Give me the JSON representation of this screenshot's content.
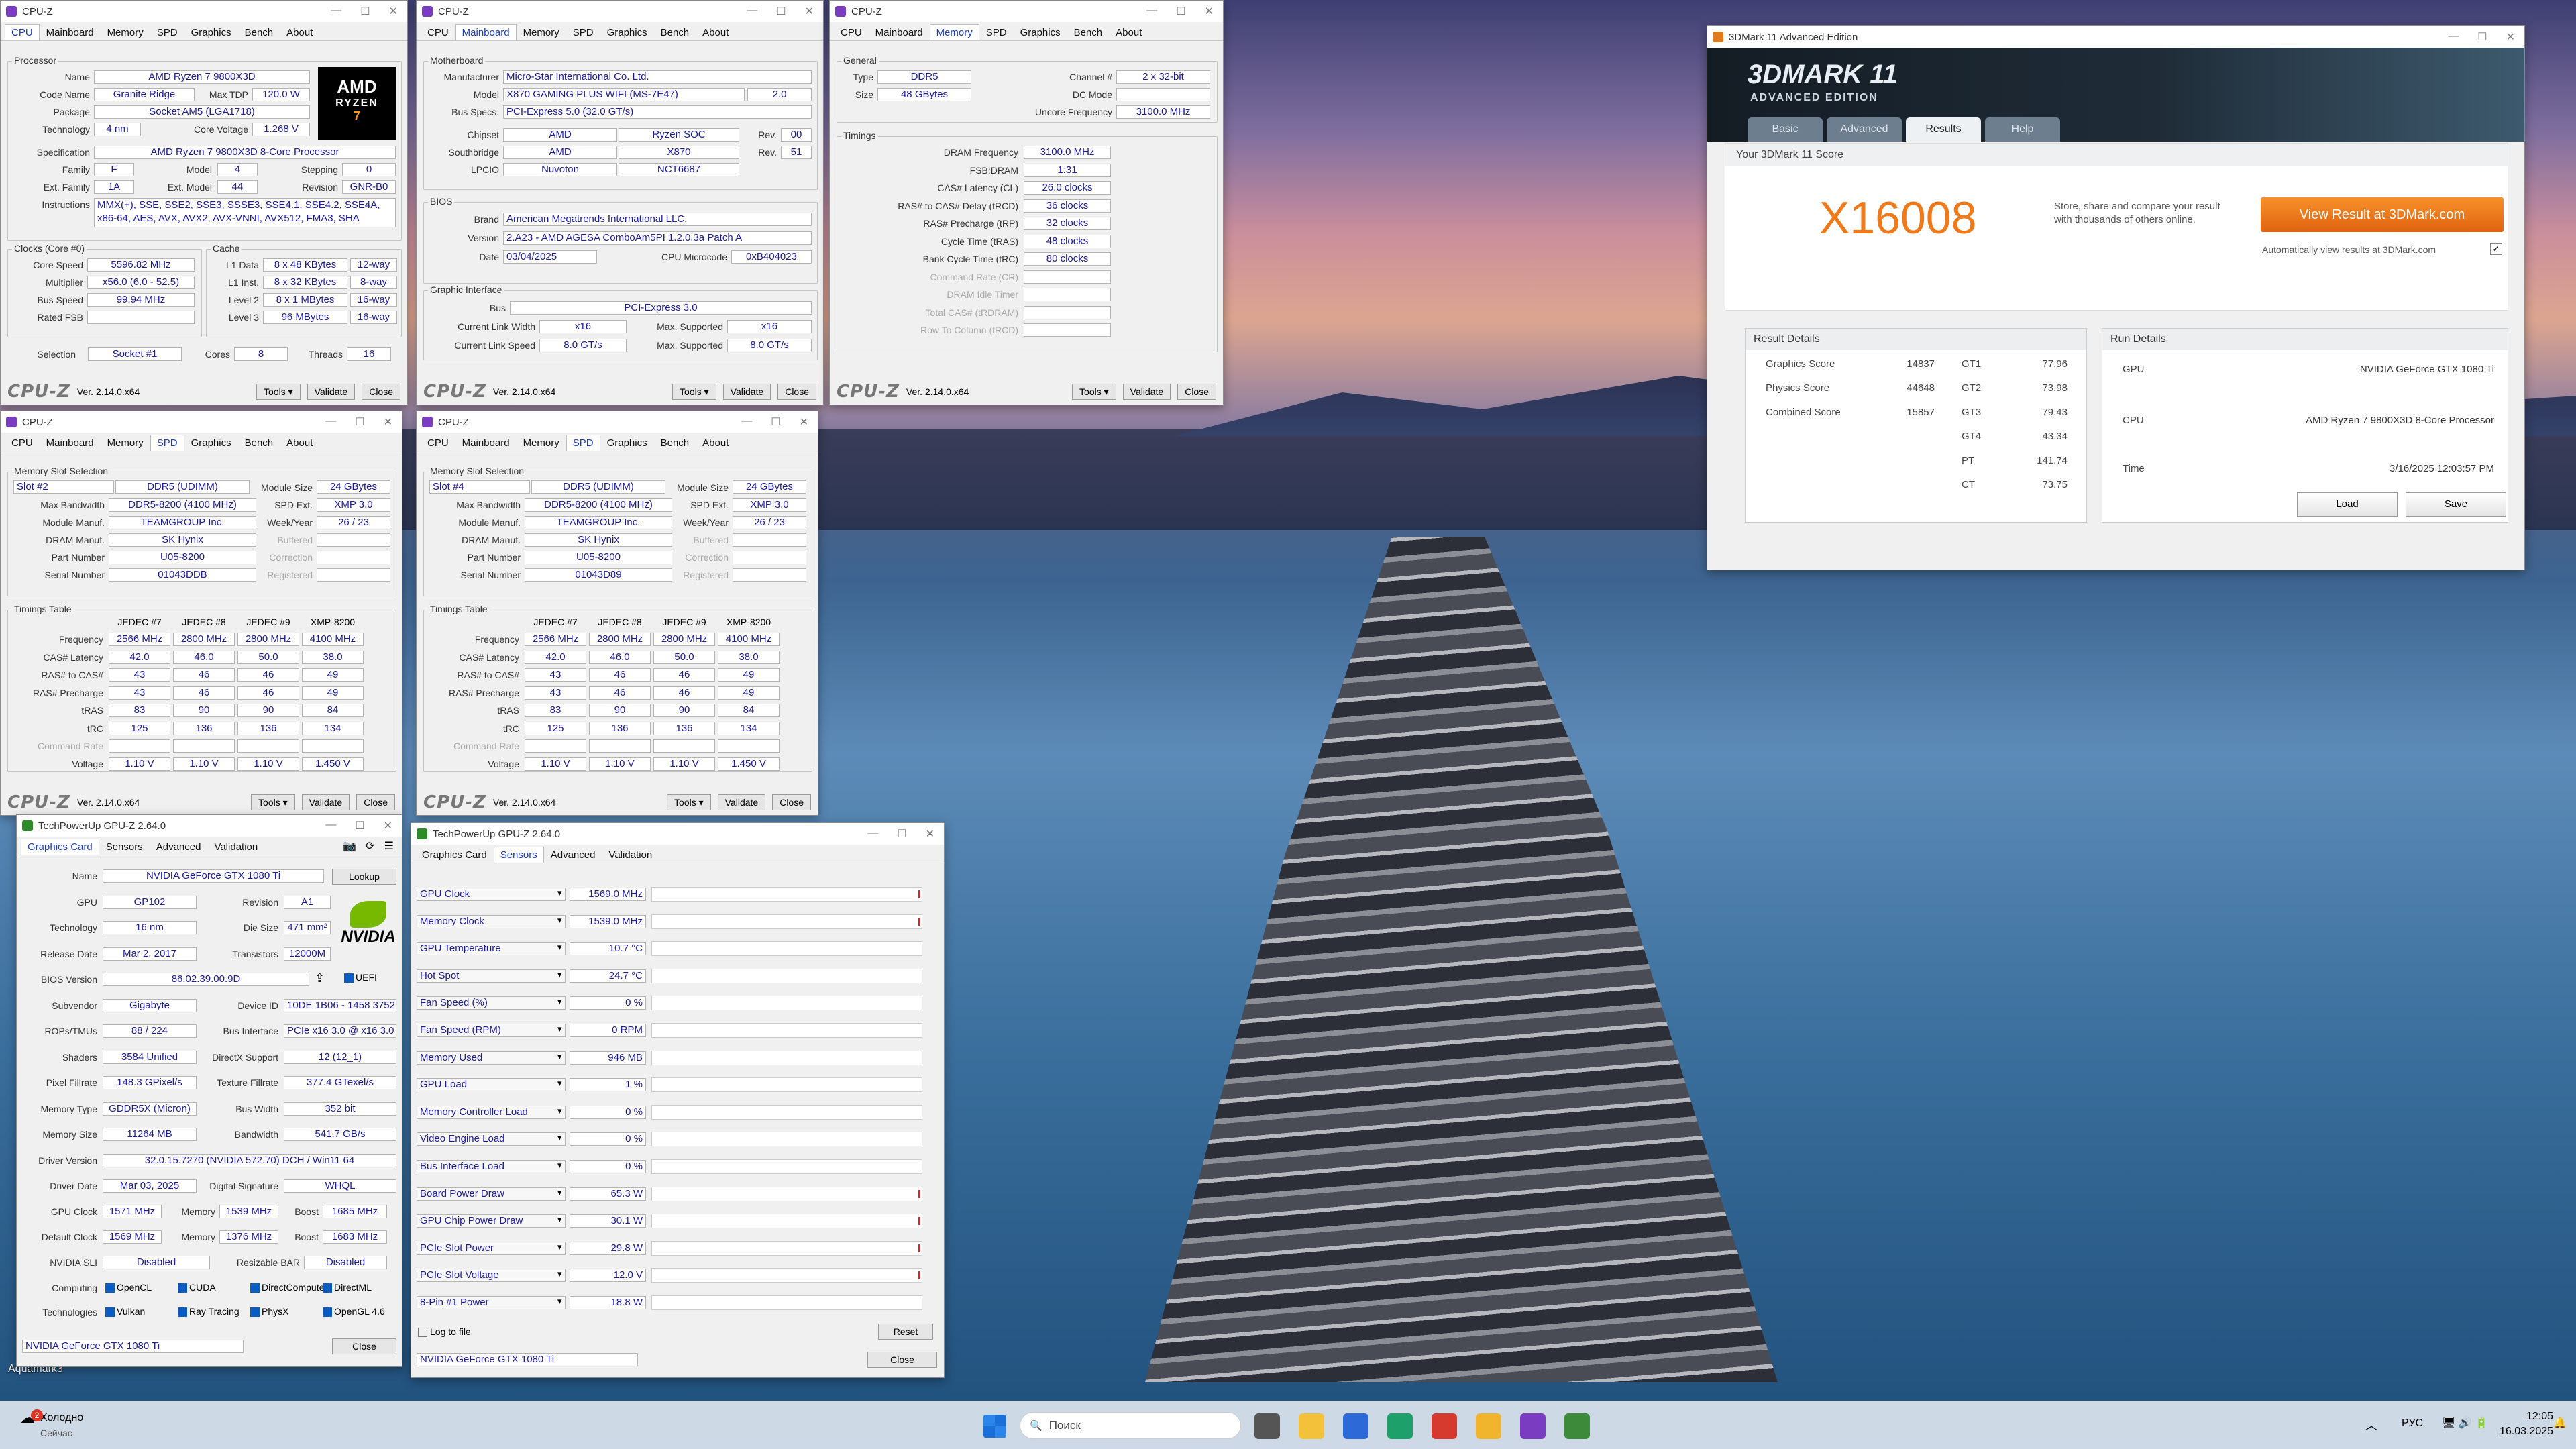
{
  "desktop": {
    "label": "Aquamark3"
  },
  "cpuz": {
    "title": "CPU-Z",
    "ver": "Ver. 2.14.0.x64",
    "tools": "Tools",
    "validate": "Validate",
    "close": "Close",
    "logo": "CPU-Z",
    "tabs": [
      "CPU",
      "Mainboard",
      "Memory",
      "SPD",
      "Graphics",
      "Bench",
      "About"
    ],
    "cpu": {
      "processor": "Processor",
      "name_l": "Name",
      "name": "AMD Ryzen 7 9800X3D",
      "code_l": "Code Name",
      "code": "Granite Ridge",
      "tdp_l": "Max TDP",
      "tdp": "120.0 W",
      "pkg_l": "Package",
      "pkg": "Socket AM5 (LGA1718)",
      "tech_l": "Technology",
      "tech": "4 nm",
      "cv_l": "Core Voltage",
      "cv": "1.268 V",
      "spec_l": "Specification",
      "spec": "AMD Ryzen 7 9800X3D 8-Core Processor",
      "fam_l": "Family",
      "fam": "F",
      "model_l": "Model",
      "model": "4",
      "step_l": "Stepping",
      "step": "0",
      "efam_l": "Ext. Family",
      "efam": "1A",
      "emod_l": "Ext. Model",
      "emod": "44",
      "rev_l": "Revision",
      "rev": "GNR-B0",
      "inst_l": "Instructions",
      "inst": "MMX(+), SSE, SSE2, SSE3, SSSE3, SSE4.1, SSE4.2, SSE4A, x86-64, AES, AVX, AVX2, AVX-VNNI, AVX512, FMA3, SHA",
      "clocks": "Clocks (Core #0)",
      "cs_l": "Core Speed",
      "cs": "5596.82 MHz",
      "mul_l": "Multiplier",
      "mul": "x56.0 (6.0 - 52.5)",
      "bus_l": "Bus Speed",
      "bus": "99.94 MHz",
      "fsb_l": "Rated FSB",
      "cache": "Cache",
      "l1d_l": "L1 Data",
      "l1d": "8 x 48 KBytes",
      "l1d_w": "12-way",
      "l1i_l": "L1 Inst.",
      "l1i": "8 x 32 KBytes",
      "l1i_w": "8-way",
      "l2_l": "Level 2",
      "l2": "8 x 1 MBytes",
      "l2_w": "16-way",
      "l3_l": "Level 3",
      "l3": "96 MBytes",
      "l3_w": "16-way",
      "sel_l": "Selection",
      "sel": "Socket #1",
      "cores_l": "Cores",
      "cores": "8",
      "thr_l": "Threads",
      "thr": "16",
      "amd_logo": "AMD",
      "ryzen": "RYZEN",
      "seven": "7"
    },
    "mb": {
      "group": "Motherboard",
      "manu_l": "Manufacturer",
      "manu": "Micro-Star International Co. Ltd.",
      "model_l": "Model",
      "model": "X870 GAMING PLUS WIFI (MS-7E47)",
      "model_rev": "2.0",
      "bus_l": "Bus Specs.",
      "bus": "PCI-Express 5.0 (32.0 GT/s)",
      "chip_l": "Chipset",
      "chip": "AMD",
      "chip2": "Ryzen SOC",
      "rev_l": "Rev.",
      "chip_rev": "00",
      "south_l": "Southbridge",
      "south": "AMD",
      "south2": "X870",
      "south_rev": "51",
      "lpc_l": "LPCIO",
      "lpc": "Nuvoton",
      "lpc2": "NCT6687",
      "bios": "BIOS",
      "brand_l": "Brand",
      "brand": "American Megatrends International LLC.",
      "bver_l": "Version",
      "bver": "2.A23 - AMD AGESA ComboAm5PI 1.2.0.3a Patch A",
      "date_l": "Date",
      "date": "03/04/2025",
      "micro_l": "CPU Microcode",
      "micro": "0xB404023",
      "gi": "Graphic Interface",
      "gbus_l": "Bus",
      "gbus": "PCI-Express 3.0",
      "clw_l": "Current Link Width",
      "clw": "x16",
      "msup_l": "Max. Supported",
      "msup": "x16",
      "cls_l": "Current Link Speed",
      "cls": "8.0 GT/s",
      "msup2": "8.0 GT/s"
    },
    "mem": {
      "general": "General",
      "type_l": "Type",
      "type": "DDR5",
      "ch_l": "Channel #",
      "ch": "2 x 32-bit",
      "size_l": "Size",
      "size": "48 GBytes",
      "dc_l": "DC Mode",
      "unc_l": "Uncore Frequency",
      "unc": "3100.0 MHz",
      "timings": "Timings",
      "rows": [
        [
          "DRAM Frequency",
          "3100.0 MHz"
        ],
        [
          "FSB:DRAM",
          "1:31"
        ],
        [
          "CAS# Latency (CL)",
          "26.0 clocks"
        ],
        [
          "RAS# to CAS# Delay (tRCD)",
          "36 clocks"
        ],
        [
          "RAS# Precharge (tRP)",
          "32 clocks"
        ],
        [
          "Cycle Time (tRAS)",
          "48 clocks"
        ],
        [
          "Bank Cycle Time (tRC)",
          "80 clocks"
        ],
        [
          "Command Rate (CR)",
          ""
        ],
        [
          "DRAM Idle Timer",
          ""
        ],
        [
          "Total CAS# (tRDRAM)",
          ""
        ],
        [
          "Row To Column (tRCD)",
          ""
        ]
      ]
    },
    "spd_a": {
      "slot": "Slot #2",
      "part": "U05-8200",
      "serial": "01043DDB"
    },
    "spd_b": {
      "slot": "Slot #4",
      "part": "U05-8200",
      "serial": "01043D89"
    },
    "spd": {
      "msel": "Memory Slot Selection",
      "type": "DDR5 (UDIMM)",
      "msize_l": "Module Size",
      "msize": "24 GBytes",
      "mbw_l": "Max Bandwidth",
      "mbw": "DDR5-8200 (4100 MHz)",
      "spdext_l": "SPD Ext.",
      "spdext": "XMP 3.0",
      "mm_l": "Module Manuf.",
      "mm": "TEAMGROUP Inc.",
      "wy_l": "Week/Year",
      "wy": "26 / 23",
      "dm_l": "DRAM Manuf.",
      "dm": "SK Hynix",
      "buf_l": "Buffered",
      "pn_l": "Part Number",
      "corr_l": "Correction",
      "sn_l": "Serial Number",
      "reg_l": "Registered",
      "tt": "Timings Table",
      "cols": [
        "JEDEC #7",
        "JEDEC #8",
        "JEDEC #9",
        "XMP-8200"
      ],
      "trows": [
        [
          "Frequency",
          "2566 MHz",
          "2800 MHz",
          "2800 MHz",
          "4100 MHz"
        ],
        [
          "CAS# Latency",
          "42.0",
          "46.0",
          "50.0",
          "38.0"
        ],
        [
          "RAS# to CAS#",
          "43",
          "46",
          "46",
          "49"
        ],
        [
          "RAS# Precharge",
          "43",
          "46",
          "46",
          "49"
        ],
        [
          "tRAS",
          "83",
          "90",
          "90",
          "84"
        ],
        [
          "tRC",
          "125",
          "136",
          "136",
          "134"
        ],
        [
          "Command Rate",
          "",
          "",
          "",
          ""
        ],
        [
          "Voltage",
          "1.10 V",
          "1.10 V",
          "1.10 V",
          "1.450 V"
        ]
      ]
    }
  },
  "gpuz": {
    "title": "TechPowerUp GPU-Z 2.64.0",
    "tabs": [
      "Graphics Card",
      "Sensors",
      "Advanced",
      "Validation"
    ],
    "card": [
      [
        "Name",
        "NVIDIA GeForce GTX 1080 Ti"
      ],
      [
        "GPU",
        "GP102",
        "Revision",
        "A1"
      ],
      [
        "Technology",
        "16 nm",
        "Die Size",
        "471 mm²"
      ],
      [
        "Release Date",
        "Mar 2, 2017",
        "Transistors",
        "12000M"
      ],
      [
        "BIOS Version",
        "86.02.39.00.9D"
      ],
      [
        "Subvendor",
        "Gigabyte",
        "Device ID",
        "10DE 1B06 - 1458 3752"
      ],
      [
        "ROPs/TMUs",
        "88 / 224",
        "Bus Interface",
        "PCIe x16 3.0 @ x16 3.0"
      ],
      [
        "Shaders",
        "3584 Unified",
        "DirectX Support",
        "12 (12_1)"
      ],
      [
        "Pixel Fillrate",
        "148.3 GPixel/s",
        "Texture Fillrate",
        "377.4 GTexel/s"
      ],
      [
        "Memory Type",
        "GDDR5X (Micron)",
        "Bus Width",
        "352 bit"
      ],
      [
        "Memory Size",
        "11264 MB",
        "Bandwidth",
        "541.7 GB/s"
      ],
      [
        "Driver Version",
        "32.0.15.7270 (NVIDIA 572.70) DCH / Win11 64"
      ],
      [
        "Driver Date",
        "Mar 03, 2025",
        "Digital Signature",
        "WHQL"
      ]
    ],
    "lookup": "Lookup",
    "uefi": "UEFI",
    "nvidia": "NVIDIA",
    "clk": [
      [
        "GPU Clock",
        "1571 MHz",
        "Memory",
        "1539 MHz",
        "Boost",
        "1685 MHz"
      ],
      [
        "Default Clock",
        "1569 MHz",
        "Memory",
        "1376 MHz",
        "Boost",
        "1683 MHz"
      ]
    ],
    "sli_l": "NVIDIA SLI",
    "sli": "Disabled",
    "rbar_l": "Resizable BAR",
    "rbar": "Disabled",
    "comp_l": "Computing",
    "comp": [
      "OpenCL",
      "CUDA",
      "DirectCompute",
      "DirectML"
    ],
    "techs_l": "Technologies",
    "techs": [
      "Vulkan",
      "Ray Tracing",
      "PhysX",
      "OpenGL 4.6"
    ],
    "select": "NVIDIA GeForce GTX 1080 Ti",
    "close": "Close",
    "sensors": [
      [
        "GPU Clock",
        "1569.0 MHz"
      ],
      [
        "Memory Clock",
        "1539.0 MHz"
      ],
      [
        "GPU Temperature",
        "10.7 °C"
      ],
      [
        "Hot Spot",
        "24.7 °C"
      ],
      [
        "Fan Speed (%)",
        "0 %"
      ],
      [
        "Fan Speed (RPM)",
        "0 RPM"
      ],
      [
        "Memory Used",
        "946 MB"
      ],
      [
        "GPU Load",
        "1 %"
      ],
      [
        "Memory Controller Load",
        "0 %"
      ],
      [
        "Video Engine Load",
        "0 %"
      ],
      [
        "Bus Interface Load",
        "0 %"
      ],
      [
        "Board Power Draw",
        "65.3 W"
      ],
      [
        "GPU Chip Power Draw",
        "30.1 W"
      ],
      [
        "PCIe Slot Power",
        "29.8 W"
      ],
      [
        "PCIe Slot Voltage",
        "12.0 V"
      ],
      [
        "8-Pin #1 Power",
        "18.8 W"
      ]
    ],
    "log": "Log to file",
    "reset": "Reset"
  },
  "mark": {
    "title": "3DMark 11 Advanced Edition",
    "logo": "3DMARK 11",
    "edition": "ADVANCED EDITION",
    "tabs": [
      "Basic",
      "Advanced",
      "Results",
      "Help"
    ],
    "score_hdr": "Your 3DMark 11 Score",
    "score": "X16008",
    "share": "Store, share and compare your result with thousands of others online.",
    "view": "View Result at 3DMark.com",
    "auto": "Automatically view results at 3DMark.com",
    "rd": "Result Details",
    "rows": [
      [
        "Graphics Score",
        "14837",
        "GT1",
        "77.96"
      ],
      [
        "Physics Score",
        "44648",
        "GT2",
        "73.98"
      ],
      [
        "Combined Score",
        "15857",
        "GT3",
        "79.43"
      ],
      [
        "",
        "",
        "GT4",
        "43.34"
      ],
      [
        "",
        "",
        "PT",
        "141.74"
      ],
      [
        "",
        "",
        "CT",
        "73.75"
      ]
    ],
    "run": "Run Details",
    "gpu_l": "GPU",
    "gpu": "NVIDIA GeForce GTX 1080 Ti",
    "cpu_l": "CPU",
    "cpu": "AMD Ryzen 7 9800X3D 8-Core Processor",
    "time_l": "Time",
    "time": "3/16/2025 12:03:57 PM",
    "load": "Load",
    "save": "Save"
  },
  "taskbar": {
    "weather": "Холодно",
    "weather2": "Сейчас",
    "badge": "2",
    "search": "Поиск",
    "lang": "РУС",
    "time": "12:05",
    "date": "16.03.2025"
  }
}
